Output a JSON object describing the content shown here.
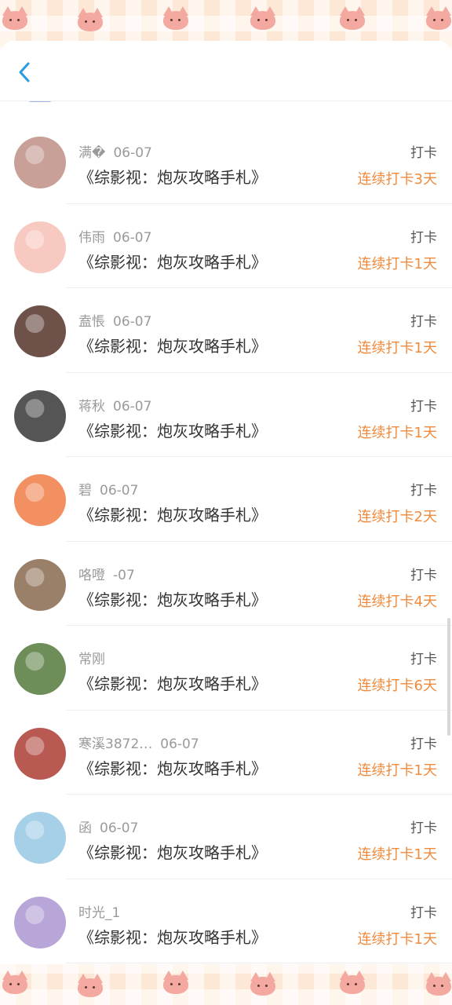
{
  "header": {
    "back_icon": "chevron-left-icon",
    "accent": "#2a9be0"
  },
  "rows": [
    {
      "name": "满�",
      "date": "06-07",
      "tag": "打卡",
      "title": "《综影视：炮灰攻略手札》",
      "streak": "连续打卡3天",
      "avatar_color": "#c8a098"
    },
    {
      "name": "伟雨",
      "date": "06-07",
      "tag": "打卡",
      "title": "《综影视：炮灰攻略手札》",
      "streak": "连续打卡1天",
      "avatar_color": "#f7c9c1"
    },
    {
      "name": "盍悵",
      "date": "06-07",
      "tag": "打卡",
      "title": "《综影视：炮灰攻略手札》",
      "streak": "连续打卡1天",
      "avatar_color": "#6e5148"
    },
    {
      "name": "蒋秋",
      "date": "06-07",
      "tag": "打卡",
      "title": "《综影视：炮灰攻略手札》",
      "streak": "连续打卡1天",
      "avatar_color": "#555555"
    },
    {
      "name": "碧",
      "date": "06-07",
      "tag": "打卡",
      "title": "《综影视：炮灰攻略手札》",
      "streak": "连续打卡2天",
      "avatar_color": "#f29062"
    },
    {
      "name": "咯噔",
      "date": "-07",
      "tag": "打卡",
      "title": "《综影视：炮灰攻略手札》",
      "streak": "连续打卡4天",
      "avatar_color": "#9b8069"
    },
    {
      "name": "常刚",
      "date": "",
      "tag": "打卡",
      "title": "《综影视：炮灰攻略手札》",
      "streak": "连续打卡6天",
      "avatar_color": "#6d8e58"
    },
    {
      "name": "寒溪3872…",
      "date": "06-07",
      "tag": "打卡",
      "title": "《综影视：炮灰攻略手札》",
      "streak": "连续打卡1天",
      "avatar_color": "#b85a52"
    },
    {
      "name": "函",
      "date": "06-07",
      "tag": "打卡",
      "title": "《综影视：炮灰攻略手札》",
      "streak": "连续打卡1天",
      "avatar_color": "#a6cfe8"
    },
    {
      "name": "时光_1",
      "date": "",
      "tag": "打卡",
      "title": "《综影视：炮灰攻略手札》",
      "streak": "连续打卡1天",
      "avatar_color": "#b9a6d8"
    }
  ]
}
